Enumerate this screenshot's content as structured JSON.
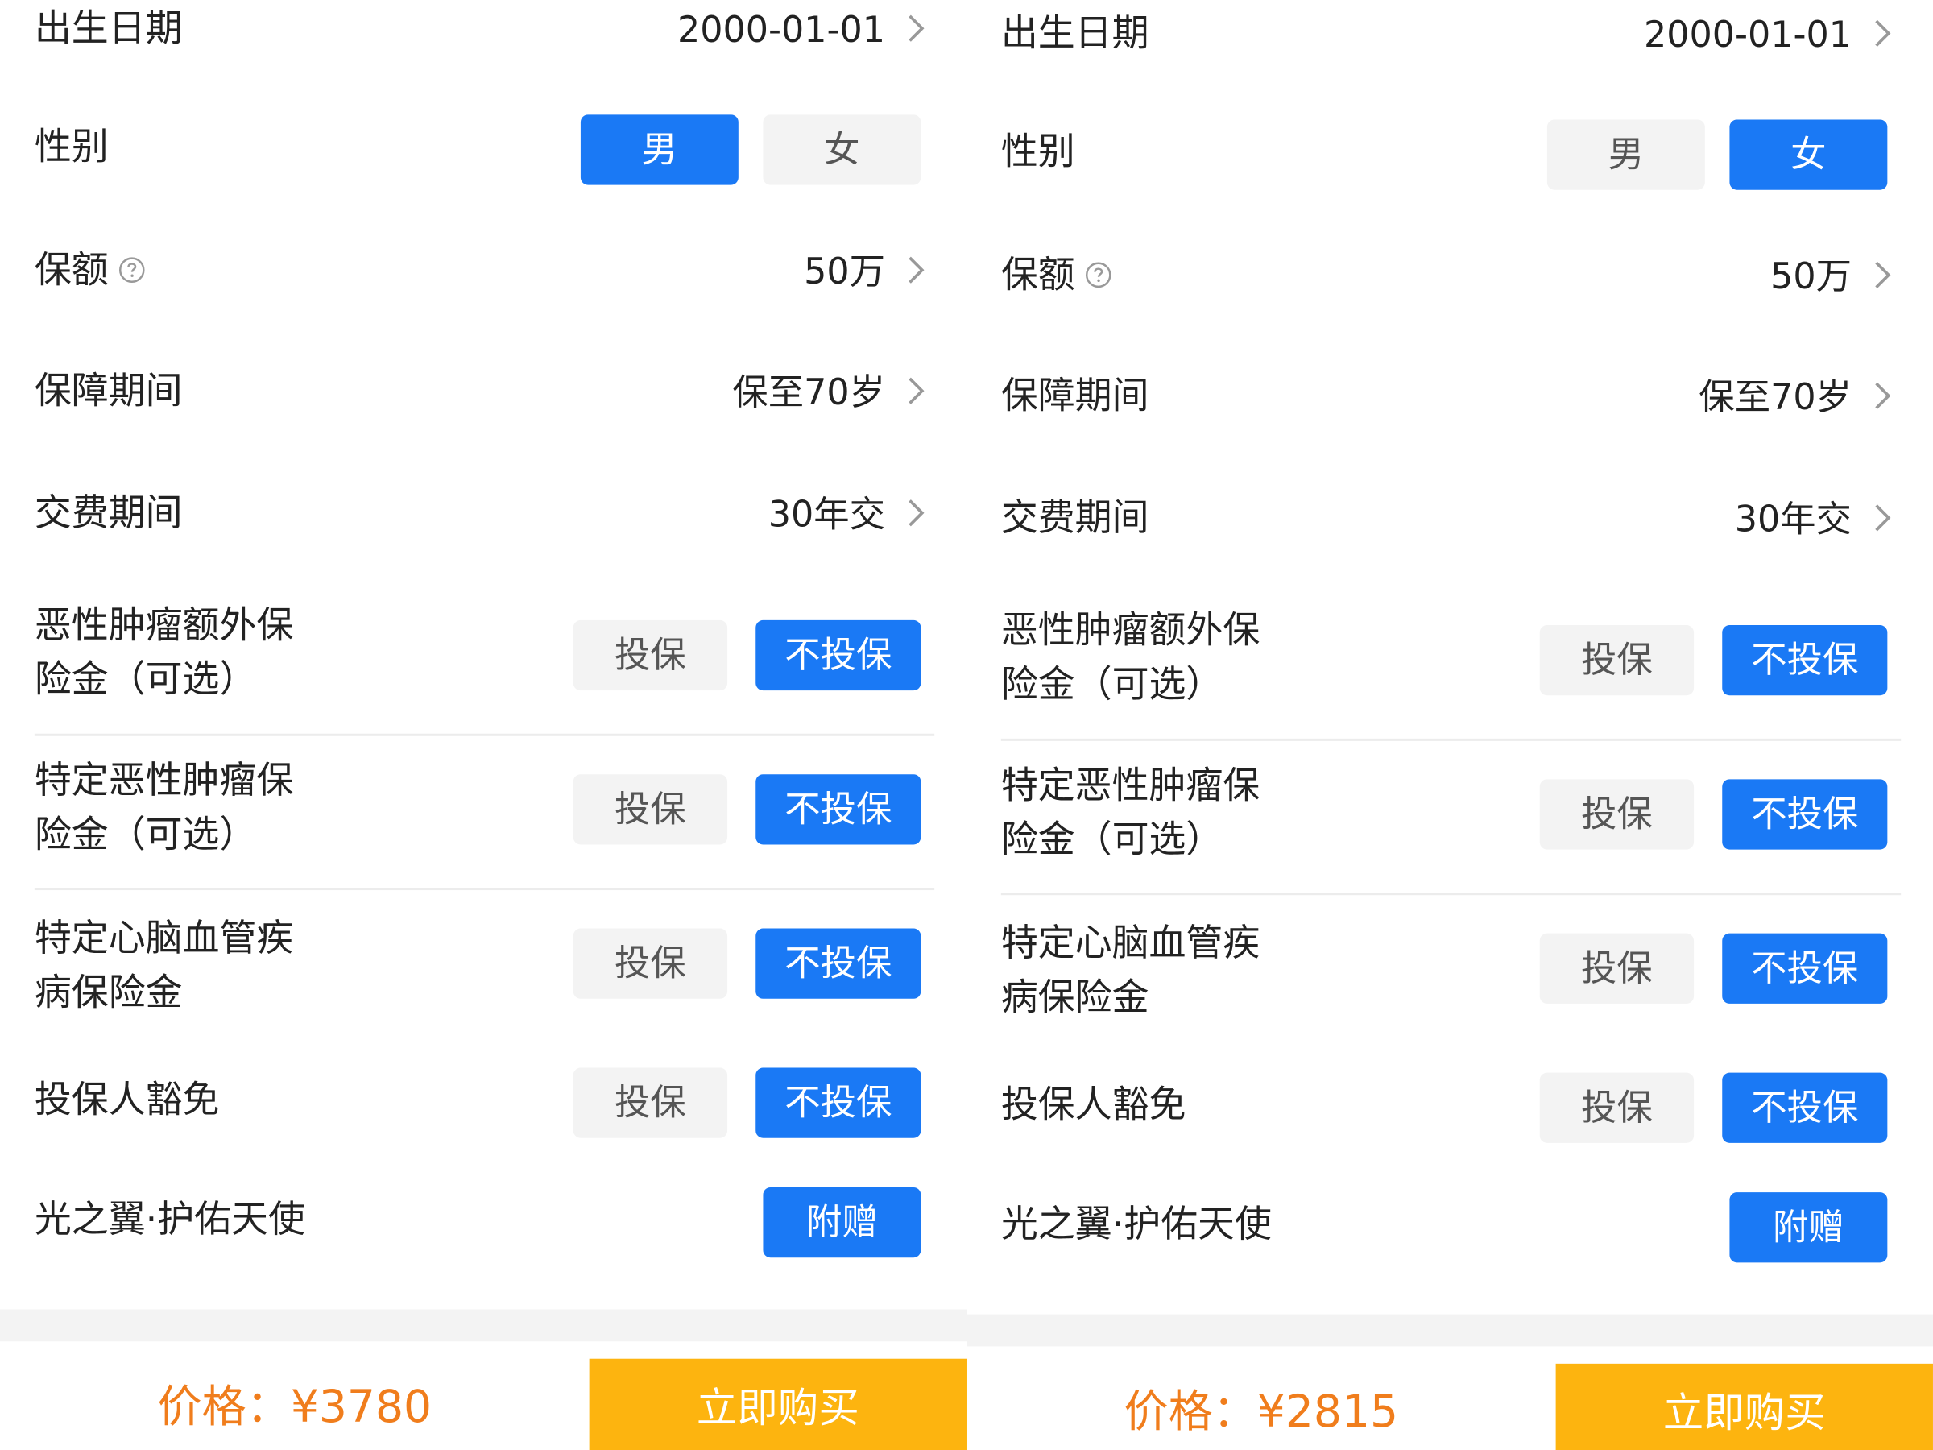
{
  "panels": [
    {
      "birth_label": "出生日期",
      "birth_value": "2000-01-01",
      "gender_label": "性别",
      "gender_male": "男",
      "gender_female": "女",
      "amount_label": "保额",
      "amount_value": "50万",
      "period_label": "保障期间",
      "period_value": "保至70岁",
      "pay_label": "交费期间",
      "pay_value": "30年交",
      "opt1_line1": "恶性肿瘤额外保",
      "opt1_line2": "险金（可选）",
      "opt2_line1": "特定恶性肿瘤保",
      "opt2_line2": "险金（可选）",
      "opt3_line1": "特定心脑血管疾",
      "opt3_line2": "病保险金",
      "opt4_label": "投保人豁免",
      "opt5_label": "光之翼·护佑天使",
      "insure": "投保",
      "no_insure": "不投保",
      "gift": "附赠",
      "price": "价格：¥3780",
      "buy": "立即购买"
    },
    {
      "birth_label": "出生日期",
      "birth_value": "2000-01-01",
      "gender_label": "性别",
      "gender_male": "男",
      "gender_female": "女",
      "amount_label": "保额",
      "amount_value": "50万",
      "period_label": "保障期间",
      "period_value": "保至70岁",
      "pay_label": "交费期间",
      "pay_value": "30年交",
      "opt1_line1": "恶性肿瘤额外保",
      "opt1_line2": "险金（可选）",
      "opt2_line1": "特定恶性肿瘤保",
      "opt2_line2": "险金（可选）",
      "opt3_line1": "特定心脑血管疾",
      "opt3_line2": "病保险金",
      "opt4_label": "投保人豁免",
      "opt5_label": "光之翼·护佑天使",
      "insure": "投保",
      "no_insure": "不投保",
      "gift": "附赠",
      "price": "价格：¥2815",
      "buy": "立即购买"
    }
  ],
  "selected_gender": [
    "male",
    "female"
  ],
  "colors": {
    "accent": "#1a79f5",
    "price": "#f07d1c",
    "buy": "#fdb40f",
    "inactive": "#f3f3f3"
  },
  "icons": {
    "chevron": "chevron-right-icon",
    "help": "question-circle-icon"
  }
}
